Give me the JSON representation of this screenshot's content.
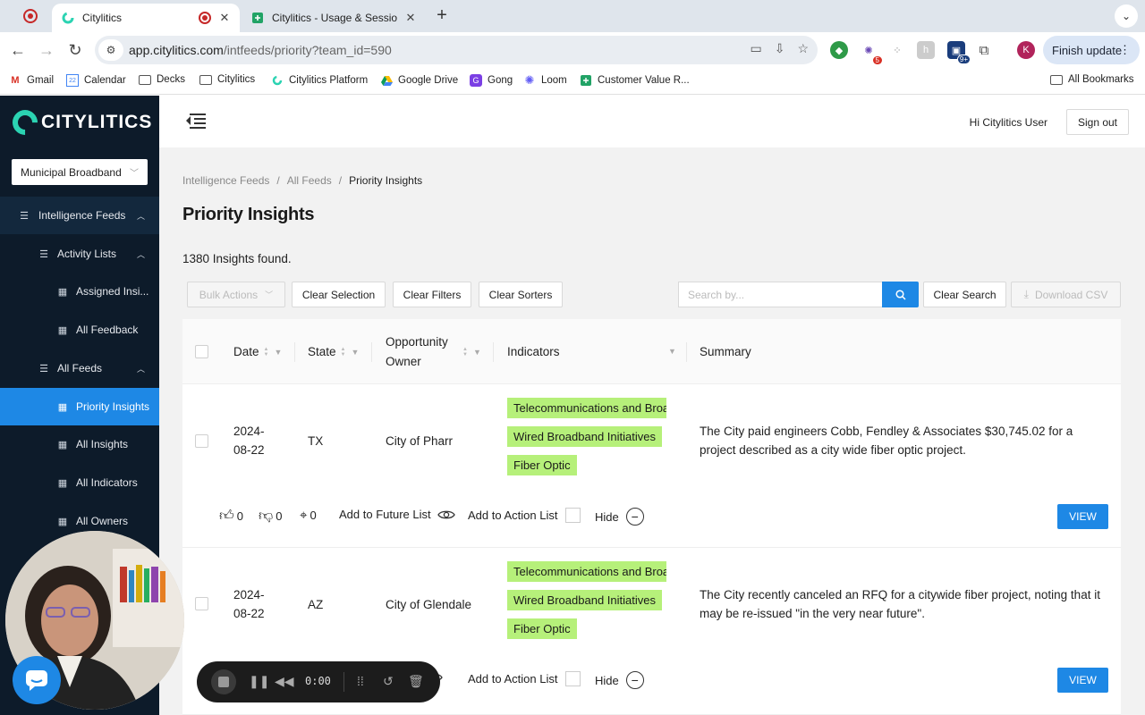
{
  "browser": {
    "tabs": [
      {
        "title": "Citylitics",
        "active": true
      },
      {
        "title": "Citylitics - Usage & Session D",
        "active": false
      }
    ],
    "url_main": "app.citylitics.com",
    "url_path": "/intfeeds/priority?team_id=590",
    "finish_update": "Finish update",
    "profile_initial": "K",
    "ext_badge_1": "5",
    "ext_badge_2": "9+",
    "bookmarks": [
      "Gmail",
      "Calendar",
      "Decks",
      "Citylitics",
      "Citylitics Platform",
      "Google Drive",
      "Gong",
      "Loom",
      "Customer Value R..."
    ],
    "all_bookmarks": "All Bookmarks",
    "calendar_day": "22"
  },
  "sidebar": {
    "logo_text": "CITYLITICS",
    "team": "Municipal Broadband",
    "items": [
      {
        "label": "Intelligence Feeds"
      },
      {
        "label": "Activity Lists"
      },
      {
        "label": "Assigned Insi..."
      },
      {
        "label": "All Feedback"
      },
      {
        "label": "All Feeds"
      },
      {
        "label": "Priority Insights"
      },
      {
        "label": "All Insights"
      },
      {
        "label": "All Indicators"
      },
      {
        "label": "All Owners"
      }
    ]
  },
  "header": {
    "greeting": "Hi Citylitics User",
    "sign_out": "Sign out"
  },
  "breadcrumb": [
    "Intelligence Feeds",
    "All Feeds",
    "Priority Insights"
  ],
  "page_title": "Priority Insights",
  "count_text": "1380 Insights found.",
  "toolbar": {
    "bulk_actions": "Bulk Actions",
    "clear_selection": "Clear Selection",
    "clear_filters": "Clear Filters",
    "clear_sorters": "Clear Sorters",
    "search_placeholder": "Search by...",
    "clear_search": "Clear Search",
    "download_csv": "Download CSV"
  },
  "table": {
    "columns": [
      "Date",
      "State",
      "Opportunity Owner",
      "Indicators",
      "Summary"
    ],
    "rows": [
      {
        "date_line1": "2024-",
        "date_line2": "08-22",
        "state": "TX",
        "owner": "City of Pharr",
        "indicators": [
          "Telecommunications and Broadband",
          "Wired Broadband Initiatives",
          "Fiber Optic"
        ],
        "summary": "The City paid engineers Cobb, Fendley & Associates $30,745.02 for a project described as a city wide fiber optic project.",
        "likes": "0",
        "dislikes": "0",
        "targets": "0"
      },
      {
        "date_line1": "2024-",
        "date_line2": "08-22",
        "state": "AZ",
        "owner": "City of Glendale",
        "indicators": [
          "Telecommunications and Broadband",
          "Wired Broadband Initiatives",
          "Fiber Optic"
        ],
        "summary": "The City recently canceled an RFQ for a citywide fiber project, noting that it may be re-issued \"in the very near future\"."
      }
    ],
    "actions": {
      "add_future": "Add to Future List",
      "add_action": "Add to Action List",
      "hide": "Hide",
      "view": "VIEW"
    }
  },
  "recorder": {
    "time": "0:00"
  },
  "colors": {
    "sidebar_bg": "#0d1b2a",
    "accent_blue": "#1e88e5",
    "tag_green": "#b6f07a",
    "logo_teal": "#2bd3b2"
  }
}
